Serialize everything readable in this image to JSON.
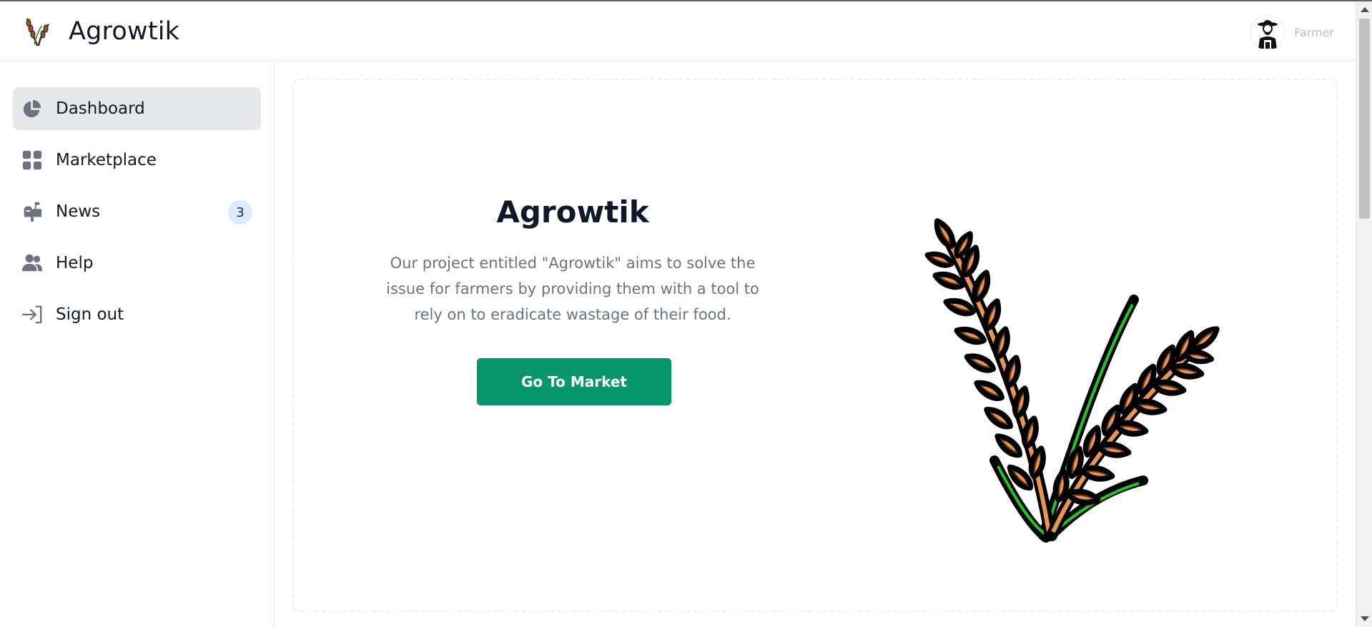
{
  "header": {
    "brand_name": "Agrowtik",
    "brand_icon": "wheat-logo-icon",
    "user_role": "Farmer",
    "avatar_icon": "farmer-avatar-icon"
  },
  "sidebar": {
    "items": [
      {
        "label": "Dashboard",
        "icon": "pie-chart-icon",
        "active": true
      },
      {
        "label": "Marketplace",
        "icon": "grid-icon"
      },
      {
        "label": "News",
        "icon": "mailbox-icon",
        "badge": "3"
      },
      {
        "label": "Help",
        "icon": "users-icon"
      },
      {
        "label": "Sign out",
        "icon": "sign-out-icon"
      }
    ]
  },
  "main": {
    "title": "Agrowtik",
    "description": "Our project entitled \"Agrowtik\" aims to solve the issue for farmers by providing them with a tool to rely on to eradicate wastage of their food.",
    "cta_label": "Go To Market",
    "illustration": "wheat-illustration-icon"
  },
  "colors": {
    "accent": "#059669",
    "active_bg": "#e5e7eb",
    "badge_bg": "#dbeafe",
    "grain": "#e8954f",
    "leaf": "#22c522"
  }
}
